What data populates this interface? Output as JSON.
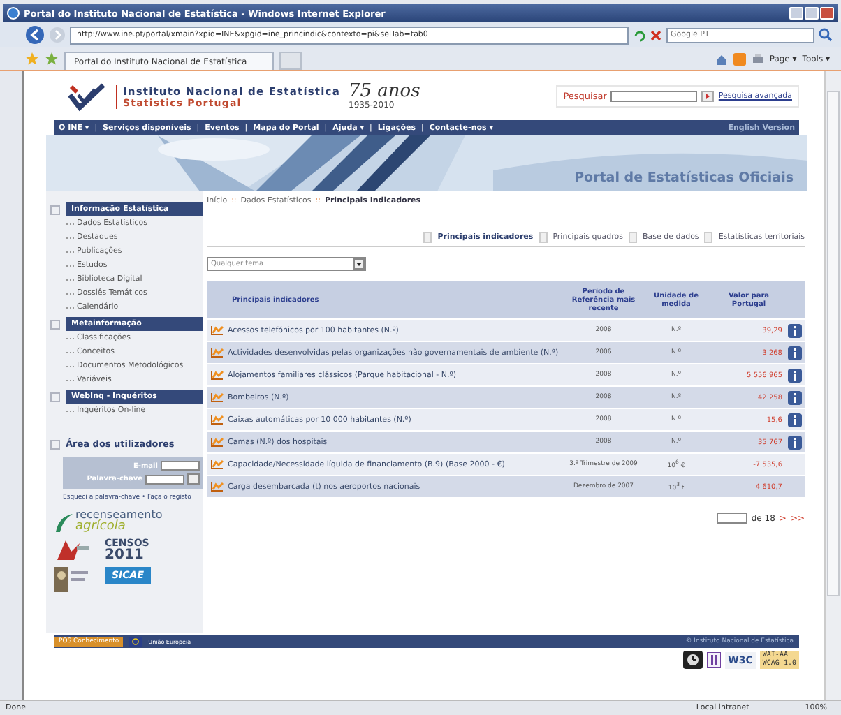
{
  "window": {
    "title": "Portal do Instituto Nacional de Estatística - Windows Internet Explorer"
  },
  "address_bar": {
    "url": "http://www.ine.pt/portal/xmain?xpid=INE&xpgid=ine_princindic&contexto=pi&selTab=tab0",
    "search_placeholder": "Google PT"
  },
  "browser_tab": {
    "title": "Portal do Instituto Nacional de Estatística"
  },
  "command_bar": [
    "Page ▾",
    "Tools ▾"
  ],
  "header": {
    "org_name": "Instituto Nacional de Estatística",
    "org_name_en": "Statistics Portugal",
    "anniversary": "75 anos",
    "anniversary_years": "1935-2010",
    "search_label": "Pesquisar",
    "advanced_search": "Pesquisa avançada"
  },
  "nav": {
    "separator": "|",
    "items": [
      "O INE ▾",
      "Serviços disponíveis",
      "Eventos",
      "Mapa do Portal",
      "Ajuda ▾",
      "Ligações",
      "Contacte-nos ▾"
    ],
    "english": "English Version"
  },
  "banner": {
    "title": "Portal de Estatísticas Oficiais"
  },
  "sidebar": {
    "sections": [
      {
        "title": "Informação Estatística",
        "items": [
          "Dados Estatísticos",
          "Destaques",
          "Publicações",
          "Estudos",
          "Biblioteca Digital",
          "Dossiês Temáticos",
          "Calendário"
        ]
      },
      {
        "title": "Metainformação",
        "items": [
          "Classificações",
          "Conceitos",
          "Documentos Metodológicos",
          "Variáveis"
        ]
      },
      {
        "title": "WebInq - Inquéritos",
        "items": [
          "Inquéritos On-line"
        ]
      }
    ],
    "login": {
      "title": "Área dos utilizadores",
      "email_label": "E-mail",
      "password_label": "Palavra-chave",
      "links": "Esqueci a palavra-chave • Faça o registo"
    },
    "logos": {
      "agri_1": "recenseamento",
      "agri_2": "agrícola",
      "census_1": "CENSOS",
      "census_2": "2011",
      "sicae": "SICAE"
    }
  },
  "breadcrumb": {
    "separator": "::",
    "items": [
      "Início",
      "Dados Estatísticos",
      "Principais Indicadores"
    ]
  },
  "tabs": [
    {
      "label": "Principais indicadores",
      "selected": true
    },
    {
      "label": "Principais quadros",
      "selected": false
    },
    {
      "label": "Base de dados",
      "selected": false
    },
    {
      "label": "Estatísticas territoriais",
      "selected": false
    }
  ],
  "theme_select": {
    "value": "Qualquer tema"
  },
  "table": {
    "columns": [
      "Principais indicadores",
      "Período de Referência mais recente",
      "Unidade de medida",
      "Valor para Portugal"
    ],
    "rows": [
      {
        "indicator": "Acessos telefónicos por 100 habitantes (N.º)",
        "period": "2008",
        "unit": "N.º",
        "value": "39,29",
        "info": true
      },
      {
        "indicator": "Actividades desenvolvidas pelas organizações não governamentais de ambiente (N.º)",
        "period": "2006",
        "unit": "N.º",
        "value": "3 268",
        "info": true
      },
      {
        "indicator": "Alojamentos familiares clássicos (Parque habitacional - N.º)",
        "period": "2008",
        "unit": "N.º",
        "value": "5 556 965",
        "info": true
      },
      {
        "indicator": "Bombeiros (N.º)",
        "period": "2008",
        "unit": "N.º",
        "value": "42 258",
        "info": true
      },
      {
        "indicator": "Caixas automáticas por 10 000 habitantes (N.º)",
        "period": "2008",
        "unit": "N.º",
        "value": "15,6",
        "info": true
      },
      {
        "indicator": "Camas (N.º) dos hospitais",
        "period": "2008",
        "unit": "N.º",
        "value": "35 767",
        "info": true
      },
      {
        "indicator": "Capacidade/Necessidade líquida de financiamento (B.9) (Base 2000 - €)",
        "period": "3.º Trimestre de 2009",
        "unit": "10$^{6}$ €",
        "value": "-7 535,6",
        "info": false
      },
      {
        "indicator": "Carga desembarcada (t) nos aeroportos nacionais",
        "period": "Dezembro de 2007",
        "unit": "10$^{3}$ t",
        "value": "4 610,7",
        "info": false
      }
    ]
  },
  "pager": {
    "of": "de 18",
    "next": ">",
    "last": ">>"
  },
  "footer": {
    "left_1": "POS Conhecimento",
    "left_2": "União Europeia",
    "copyright": "© Instituto Nacional de Estatística",
    "badge_1": "W3C",
    "badge_2": "WAI-AA",
    "badge_3": "WCAG 1.0"
  },
  "status_bar": {
    "text": "Done",
    "zone": "Local intranet",
    "zoom": "100%"
  }
}
